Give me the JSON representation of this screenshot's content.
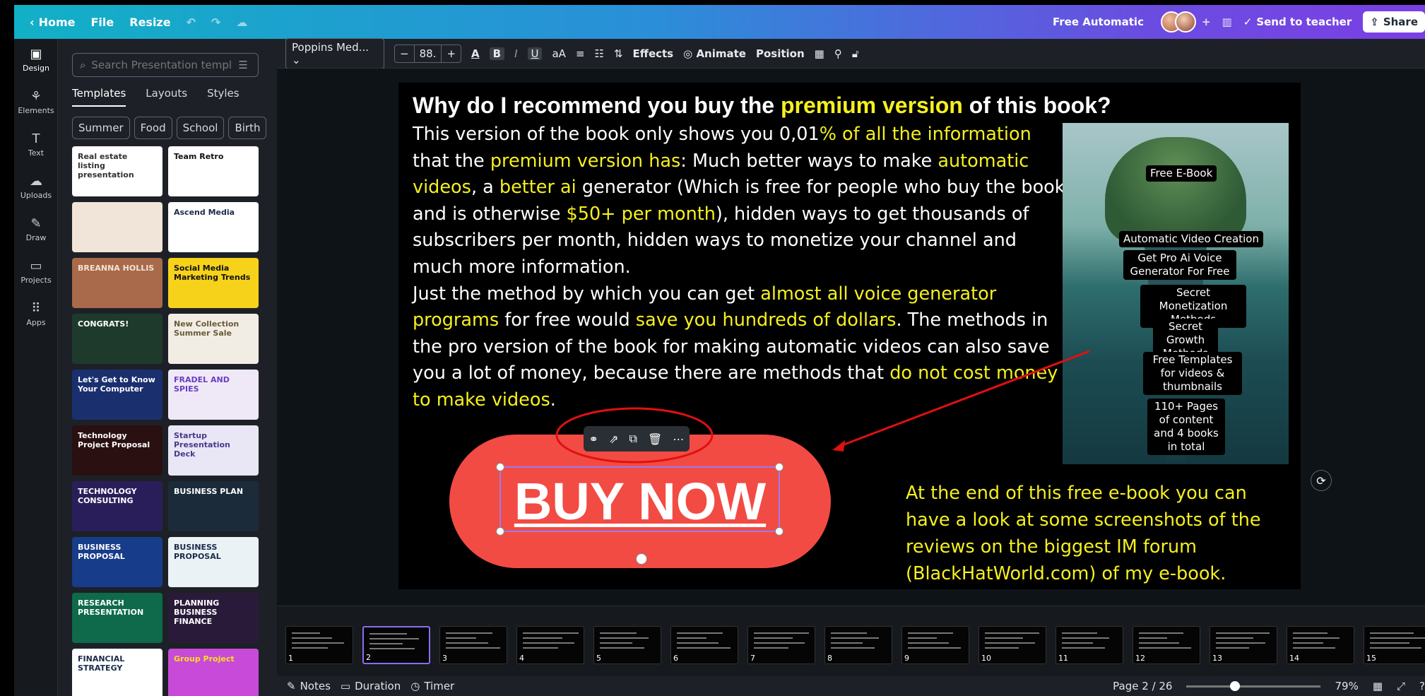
{
  "topbar": {
    "home": "Home",
    "file": "File",
    "resize": "Resize",
    "title": "Free Automatic",
    "send_to_teacher": "Send to teacher",
    "share": "Share"
  },
  "rail": [
    {
      "label": "Design",
      "icon": "design-icon"
    },
    {
      "label": "Elements",
      "icon": "elements-icon"
    },
    {
      "label": "Text",
      "icon": "text-icon"
    },
    {
      "label": "Uploads",
      "icon": "uploads-icon"
    },
    {
      "label": "Draw",
      "icon": "draw-icon"
    },
    {
      "label": "Projects",
      "icon": "projects-icon"
    },
    {
      "label": "Apps",
      "icon": "apps-icon"
    }
  ],
  "panel": {
    "search_placeholder": "Search Presentation templ",
    "tabs": [
      "Templates",
      "Layouts",
      "Styles"
    ],
    "chips": [
      "Summer",
      "Food",
      "School",
      "Birth"
    ],
    "thumbs": [
      {
        "text": "Real estate listing presentation",
        "bg": "#ffffff",
        "fg": "#333333"
      },
      {
        "text": "Team Retro",
        "bg": "#ffffff",
        "fg": "#111111"
      },
      {
        "text": "",
        "bg": "#f1e4d8",
        "fg": "#6a4a3a"
      },
      {
        "text": "Ascend Media",
        "bg": "#ffffff",
        "fg": "#1b2b4a"
      },
      {
        "text": "BREANNA HOLLIS",
        "bg": "#a86a4a",
        "fg": "#f3e3d3"
      },
      {
        "text": "Social Media Marketing Trends",
        "bg": "#f6d21a",
        "fg": "#111111"
      },
      {
        "text": "CONGRATS!",
        "bg": "#1e3a2c",
        "fg": "#ffffff"
      },
      {
        "text": "New Collection Summer Sale",
        "bg": "#f1ede4",
        "fg": "#6a5a3a"
      },
      {
        "text": "Let's Get to Know Your Computer",
        "bg": "#1a2f6e",
        "fg": "#ffffff"
      },
      {
        "text": "FRADEL AND SPIES",
        "bg": "#efe9f7",
        "fg": "#6a3ec0"
      },
      {
        "text": "Technology Project Proposal",
        "bg": "#2a1010",
        "fg": "#ffffff"
      },
      {
        "text": "Startup Presentation Deck",
        "bg": "#e9e6f5",
        "fg": "#4a3a8a"
      },
      {
        "text": "TECHNOLOGY CONSULTING",
        "bg": "#2a1e5a",
        "fg": "#ffffff"
      },
      {
        "text": "BUSINESS PLAN",
        "bg": "#1b2b3a",
        "fg": "#ffffff"
      },
      {
        "text": "BUSINESS PROPOSAL",
        "bg": "#173c8a",
        "fg": "#ffffff"
      },
      {
        "text": "BUSINESS PROPOSAL",
        "bg": "#eaf2f5",
        "fg": "#1b2b4a"
      },
      {
        "text": "RESEARCH PRESENTATION",
        "bg": "#0e6a4a",
        "fg": "#ffffff"
      },
      {
        "text": "PLANNING BUSINESS FINANCE",
        "bg": "#2a1a3a",
        "fg": "#ffffff"
      },
      {
        "text": "FINANCIAL STRATEGY",
        "bg": "#ffffff",
        "fg": "#1b2b4a"
      },
      {
        "text": "Group Project",
        "bg": "#c84ad8",
        "fg": "#f6e21a"
      }
    ]
  },
  "toolbar": {
    "font": "Poppins Med...",
    "size": "88.",
    "effects": "Effects",
    "animate": "Animate",
    "position": "Position"
  },
  "slide": {
    "title_a": "Why do I recommend you buy the ",
    "title_b": "premium version",
    "title_c": " of this book?",
    "p1_a": "This version of the book only shows you 0,01",
    "p1_b": "% of all the information",
    "p1_c": " that the ",
    "p1_d": "premium version has",
    "p1_e": ": Much better ways to make ",
    "p1_f": "automatic videos",
    "p1_g": ", a ",
    "p1_h": "better ai",
    "p1_i": " generator (Which is free for people who buy the book and is otherwise ",
    "p1_j": "$50+ per month",
    "p1_k": "), hidden ways to get thousands of subscribers per month, hidden ways to monetize your channel and much more information.",
    "p2_a": "Just the method by which you can get ",
    "p2_b": "almost all voice generator programs",
    "p2_c": " for free would ",
    "p2_d": "save you hundreds of dollars",
    "p2_e": ". The methods in the pro version of the book for making automatic videos can also save you a lot of money, because there are methods that ",
    "p2_f": "do not cost money to make videos",
    "p2_g": ".",
    "image_labels": [
      "Free E-Book",
      "Automatic Video Creation",
      "Get Pro Ai Voice Generator For Free",
      "Secret Monetization Methods",
      "Secret Growth Methods",
      "Free Templates for videos & thumbnails",
      "110+ Pages of content and 4 books in total"
    ],
    "button": "BUY NOW",
    "footer": "At the end of this free e-book you can have a look at some screenshots of the reviews on the biggest IM forum (BlackHatWorld.com) of my e-book."
  },
  "filmstrip": {
    "pages": [
      "1",
      "2",
      "3",
      "4",
      "5",
      "6",
      "7",
      "8",
      "9",
      "10",
      "11",
      "12",
      "13",
      "14",
      "15"
    ],
    "first_title": "Automatic Video Creation"
  },
  "bottom": {
    "notes": "Notes",
    "duration": "Duration",
    "timer": "Timer",
    "page": "Page 2 / 26",
    "zoom": "79%",
    "zoom_level": 0.36
  },
  "colors": {
    "accent_yellow": "#f5f01e",
    "button_red": "#f24b43",
    "selection": "#9b7bf0"
  }
}
